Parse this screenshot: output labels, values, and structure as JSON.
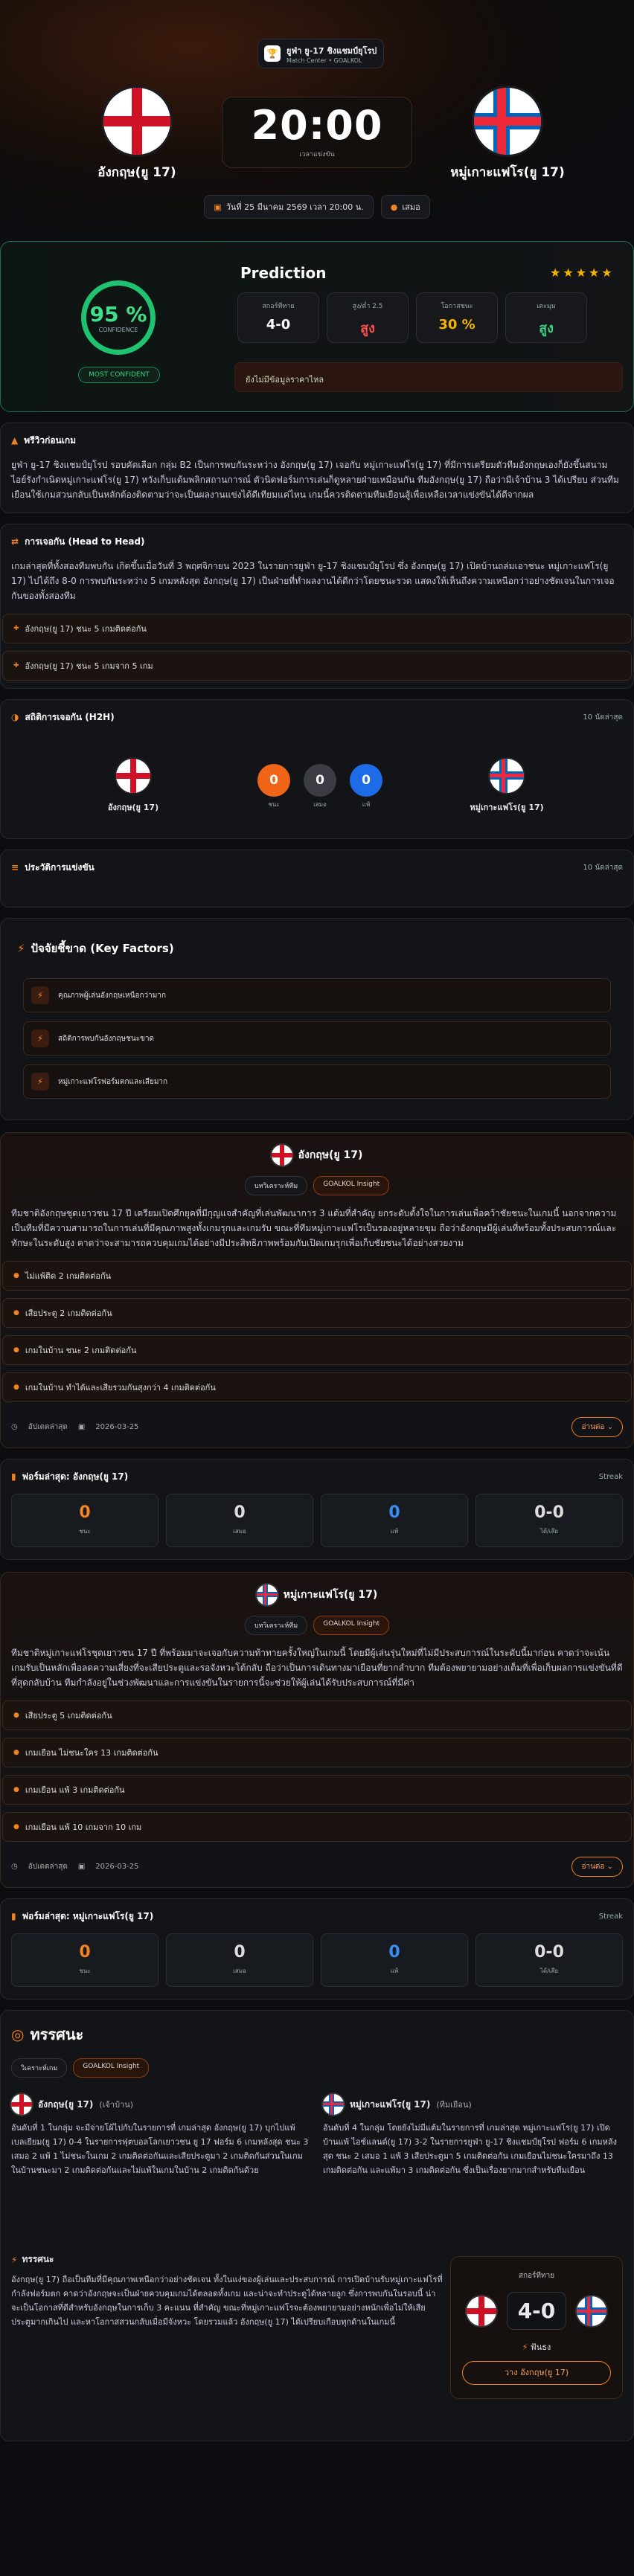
{
  "match": {
    "league_name": "ยูฟ่า ยู-17 ชิงแชมป์ยุโรป",
    "league_sub": "Match Center • GOALKOL",
    "home": "อังกฤษ(ยู 17)",
    "away": "หมู่เกาะแฟโร(ยู 17)",
    "time": "20:00",
    "time_sub": "เวลาแข่งขัน",
    "date": "วันที่ 25 มีนาคม 2569 เวลา 20:00 น.",
    "venue": "เสมอ"
  },
  "prediction": {
    "percent": "95 %",
    "confidence": "CONFIDENCE",
    "badge": "MOST CONFIDENT",
    "title": "Prediction",
    "stars": "★★★★★",
    "boxes": [
      {
        "label": "สกอร์ทีทาย",
        "value": "4-0",
        "color": "#ffffff"
      },
      {
        "label": "สูง/ต่ำ 2.5",
        "value": "สูง",
        "color": "#ff4d4d"
      },
      {
        "label": "โอกาสชนะ",
        "value": "30 %",
        "color": "#f5b400"
      },
      {
        "label": "เตะมุม",
        "value": "สูง",
        "color": "#39d07f"
      }
    ],
    "note": "ยังไม่มีข้อมูลราคาไหล"
  },
  "preview": {
    "title": "พรีวิวก่อนเกม",
    "text": "ยูฟ่า ยู-17 ชิงแชมป์ยุโรป รอบคัดเลือก กลุ่ม B2 เป็นการพบกันระหว่าง อังกฤษ(ยู 17) เจอกับ หมู่เกาะแฟโร(ยู 17) ที่มีการเตรียมตัวทีมอังกฤษเองก็ยังขึ้นสนาม ไอย์รังกำเนิดหมู่เกาะแฟโร(ยู 17) หวังเก็บแต้มพลิกสถานการณ์ ตัวนิดฟอร์มการเล่นก็ดูหลายฝ่ายเหมือนกัน ทีมอังกฤษ(ยู 17) ถือว่ามีเจ้าบ้าน 3 ได้เปรียบ ส่วนทีมเยือนใช้เกมสวนกลับเป็นหลักต้องติดตามว่าจะเป็นผลงานแข่งได้ดีเทียมแค่ไหน เกมนี้ควรติดตามทีมเยือนสู้เพื่อเหลือเวลาแข่งขันได้ดีจากผล"
  },
  "h2h_note": {
    "title": "การเจอกัน (Head to Head)",
    "text": "เกมล่าสุดที่ทั้งสองทีมพบกัน เกิดขึ้นเมื่อวันที่ 3 พฤศจิกายน 2023 ในรายการยูฟ่า ยู-17 ชิงแชมป์ยุโรป ซึ่ง อังกฤษ(ยู 17) เปิดบ้านถล่มเอาชนะ หมู่เกาะแฟโร(ยู 17) ไปได้ถึง 8-0 การพบกันระหว่าง 5 เกมหลังสุด อังกฤษ(ยู 17) เป็นฝ่ายที่ทำผลงานได้ดีกว่าโดยชนะรวด แสดงให้เห็นถึงความเหนือกว่าอย่างชัดเจนในการเจอกันของทั้งสองทีม",
    "items": [
      "อังกฤษ(ยู 17) ชนะ 5 เกมติดต่อกัน",
      "อังกฤษ(ยู 17) ชนะ 5 เกมจาก 5 เกม"
    ]
  },
  "h2h": {
    "title": "สถิติการเจอกัน (H2H)",
    "count": "10 นัดล่าสุด",
    "home": "อังกฤษ(ยู 17)",
    "away": "หมู่เกาะแฟโร(ยู 17)",
    "wins": "0",
    "draws": "0",
    "losses": "0",
    "w_label": "ชนะ",
    "d_label": "เสมอ",
    "l_label": "แพ้"
  },
  "history": {
    "title": "ประวัติการแข่งขัน",
    "count": "10 นัดล่าสุด"
  },
  "keyfactors": {
    "title": "ปัจจัยชี้ขาด (Key Factors)",
    "items": [
      "คุณภาพผู้เล่นอังกฤษเหนือกว่ามาก",
      "สถิติการพบกันอังกฤษชนะขาด",
      "หมู่เกาะแฟโรฟอร์มตกและเสียมาก"
    ]
  },
  "home_insight": {
    "team": "อังกฤษ(ยู 17)",
    "tag1": "บทวิเคราะห์ทีม",
    "tag2": "GOALKOL Insight",
    "text": "ทีมชาติอังกฤษชุดเยาวชน 17 ปี เตรียมเปิดศึกยุคที่มีกุญแจสำคัญที่เล่นพัฒนาการ 3 แต้มที่สำคัญ ยกระดับตั้งใจในการเล่นเพื่อคว้าชัยชนะในเกมนี้ นอกจากความเป็นทีมที่มีความสามารถในการเล่นที่มีคุณภาพสูงทั้งเกมรุกและเกมรับ ขณะที่ทีมหมู่เกาะแฟโรเป็นรองอยู่หลายขุม ถือว่าอังกฤษมีผู้เล่นที่พร้อมทั้งประสบการณ์และทักษะในระดับสูง คาดว่าจะสามารถควบคุมเกมได้อย่างมีประสิทธิภาพพร้อมกับเปิดเกมรุกเพื่อเก็บชัยชนะได้อย่างสวยงาม",
    "items": [
      "ไม่แพ้ติด 2 เกมติดต่อกัน",
      "เสียประตู 2 เกมติดต่อกัน",
      "เกมในบ้าน ชนะ 2 เกมติดต่อกัน",
      "เกมในบ้าน ทำได้และเสียรวมกันสุงกว่า 4 เกมติดต่อกัน"
    ],
    "updated": "อัปเดตล่าสุด",
    "date": "2026-03-25",
    "more": "อ่านต่อ"
  },
  "home_form": {
    "title": "ฟอร์มล่าสุด: อังกฤษ(ยู 17)",
    "streak": "Streak",
    "vals": [
      "0",
      "0",
      "0",
      "0-0"
    ],
    "labels": [
      "ชนะ",
      "เสมอ",
      "แพ้",
      "ได้/เสีย"
    ]
  },
  "away_insight": {
    "team": "หมู่เกาะแฟโร(ยู 17)",
    "tag1": "บทวิเคราะห์ทีม",
    "tag2": "GOALKOL Insight",
    "text": "ทีมชาติหมู่เกาะแฟโรชุดเยาวชน 17 ปี ที่พร้อมมาจะเจอกับความท้าทายครั้งใหญ่ในเกมนี้ โดยมีผู้เล่นรุ่นใหม่ที่ไม่มีประสบการณ์ในระดับนี้มาก่อน คาดว่าจะเน้นเกมรับเป็นหลักเพื่อลดความเสี่ยงที่จะเสียประตูและรอจังหวะโต้กลับ ถือว่าเป็นการเดินทางมาเยือนที่ยากลำบาก ทีมต้องพยายามอย่างเต็มที่เพื่อเก็บผลการแข่งขันที่ดีที่สุดกลับบ้าน ทีมกำลังอยู่ในช่วงพัฒนาและการแข่งขันในรายการนี้จะช่วยให้ผู้เล่นได้รับประสบการณ์ที่มีค่า",
    "items": [
      "เสียประตู 5 เกมติดต่อกัน",
      "เกมเยือน ไม่ชนะใคร 13 เกมติดต่อกัน",
      "เกมเยือน แพ้ 3 เกมติดต่อกัน",
      "เกมเยือน แพ้ 10 เกมจาก 10 เกม"
    ],
    "updated": "อัปเดตล่าสุด",
    "date": "2026-03-25",
    "more": "อ่านต่อ"
  },
  "away_form": {
    "title": "ฟอร์มล่าสุด: หมู่เกาะแฟโร(ยู 17)",
    "streak": "Streak",
    "vals": [
      "0",
      "0",
      "0",
      "0-0"
    ],
    "labels": [
      "ชนะ",
      "เสมอ",
      "แพ้",
      "ได้/เสีย"
    ]
  },
  "analysis": {
    "title": "ทรรศนะ",
    "tag1": "วิเคราะห์เกม",
    "tag2": "GOALKOL Insight",
    "home": "อังกฤษ(ยู 17)",
    "home_s": "(เจ้าบ้าน)",
    "away": "หมู่เกาะแฟโร(ยู 17)",
    "away_s": "(ทีมเยือน)",
    "home_text": "อันดับที่ 1 ในกลุ่ม จะมีจ่ายโผ้ไปกับในรายการที่ เกมล่าสุด อังกฤษ(ยู 17) บุกไปแพ้ เบลเยียม(ยู 17) 0-4 ในรายการฟุตบอลโลกเยาวชน ยู 17 ฟอร์ม 6 เกมหลังสุด ชนะ 3 เสมอ 2 แพ้ 1 ไม่ชนะในเกม 2 เกมติดต่อกันและเสียประตูมา 2 เกมติดกันส่วนในเกมในบ้านชนะมา 2 เกมติดต่อกันและไม่แพ้ในเกมในบ้าน 2 เกมติดกันด้วย",
    "away_text": "อันดับที่ 4 ในกลุ่ม โดยยังไม่มีแต้มในรายการที่ เกมล่าสุด หมู่เกาะแฟโร(ยู 17) เปิดบ้านแพ้ ไอซ์แลนด์(ยู 17) 3-2 ในรายการยูฟ่า ยู-17 ชิงแชมป์ยุโรป ฟอร์ม 6 เกมหลังสุด ชนะ 2 เสมอ 1 แพ้ 3 เสียประตูมา 5 เกมติดต่อกัน เกมเยือนไม่ชนะใครมาถึง 13 เกมติดต่อกัน และแพ้มา 3 เกมติดต่อกัน ซึ่งเป็นเรื่องยากมากสำหรับทีมเยือน",
    "sub_title": "ทรรศนะ",
    "sub_text": "อังกฤษ(ยู 17) ถือเป็นทีมที่มีคุณภาพเหนือกว่าอย่างชัดเจน ทั้งในแง่ของผู้เล่นและประสบการณ์ การเปิดบ้านรับหมู่เกาะแฟโรที่กำลังฟอร์มตก คาดว่าอังกฤษจะเป็นฝ่ายควบคุมเกมได้ตลอดทั้งเกม และน่าจะทำประตูได้หลายลูก ซึ่งการพบกันในรอบนี้ น่าจะเป็นโอกาสที่ดีสำหรับอังกฤษในการเก็บ 3 คะแนน ที่สำคัญ ขณะที่หมู่เกาะแฟโรจะต้องพยายามอย่างหนักเพื่อไม่ให้เสียประตูมากเกินไป และหาโอกาสสวนกลับเมื่อมีจังหวะ โดยรวมแล้ว อังกฤษ(ยู 17) ได้เปรียบเกือบทุกด้านในเกมนี้",
    "pick_title": "สกอร์ทีทาย",
    "pick_score": "4-0",
    "pick_odds": "ฟันธง",
    "pick_btn": "วาง อังกฤษ(ยู 17)"
  },
  "colors": {
    "accent": "#f58220",
    "green": "#1ec26f"
  }
}
